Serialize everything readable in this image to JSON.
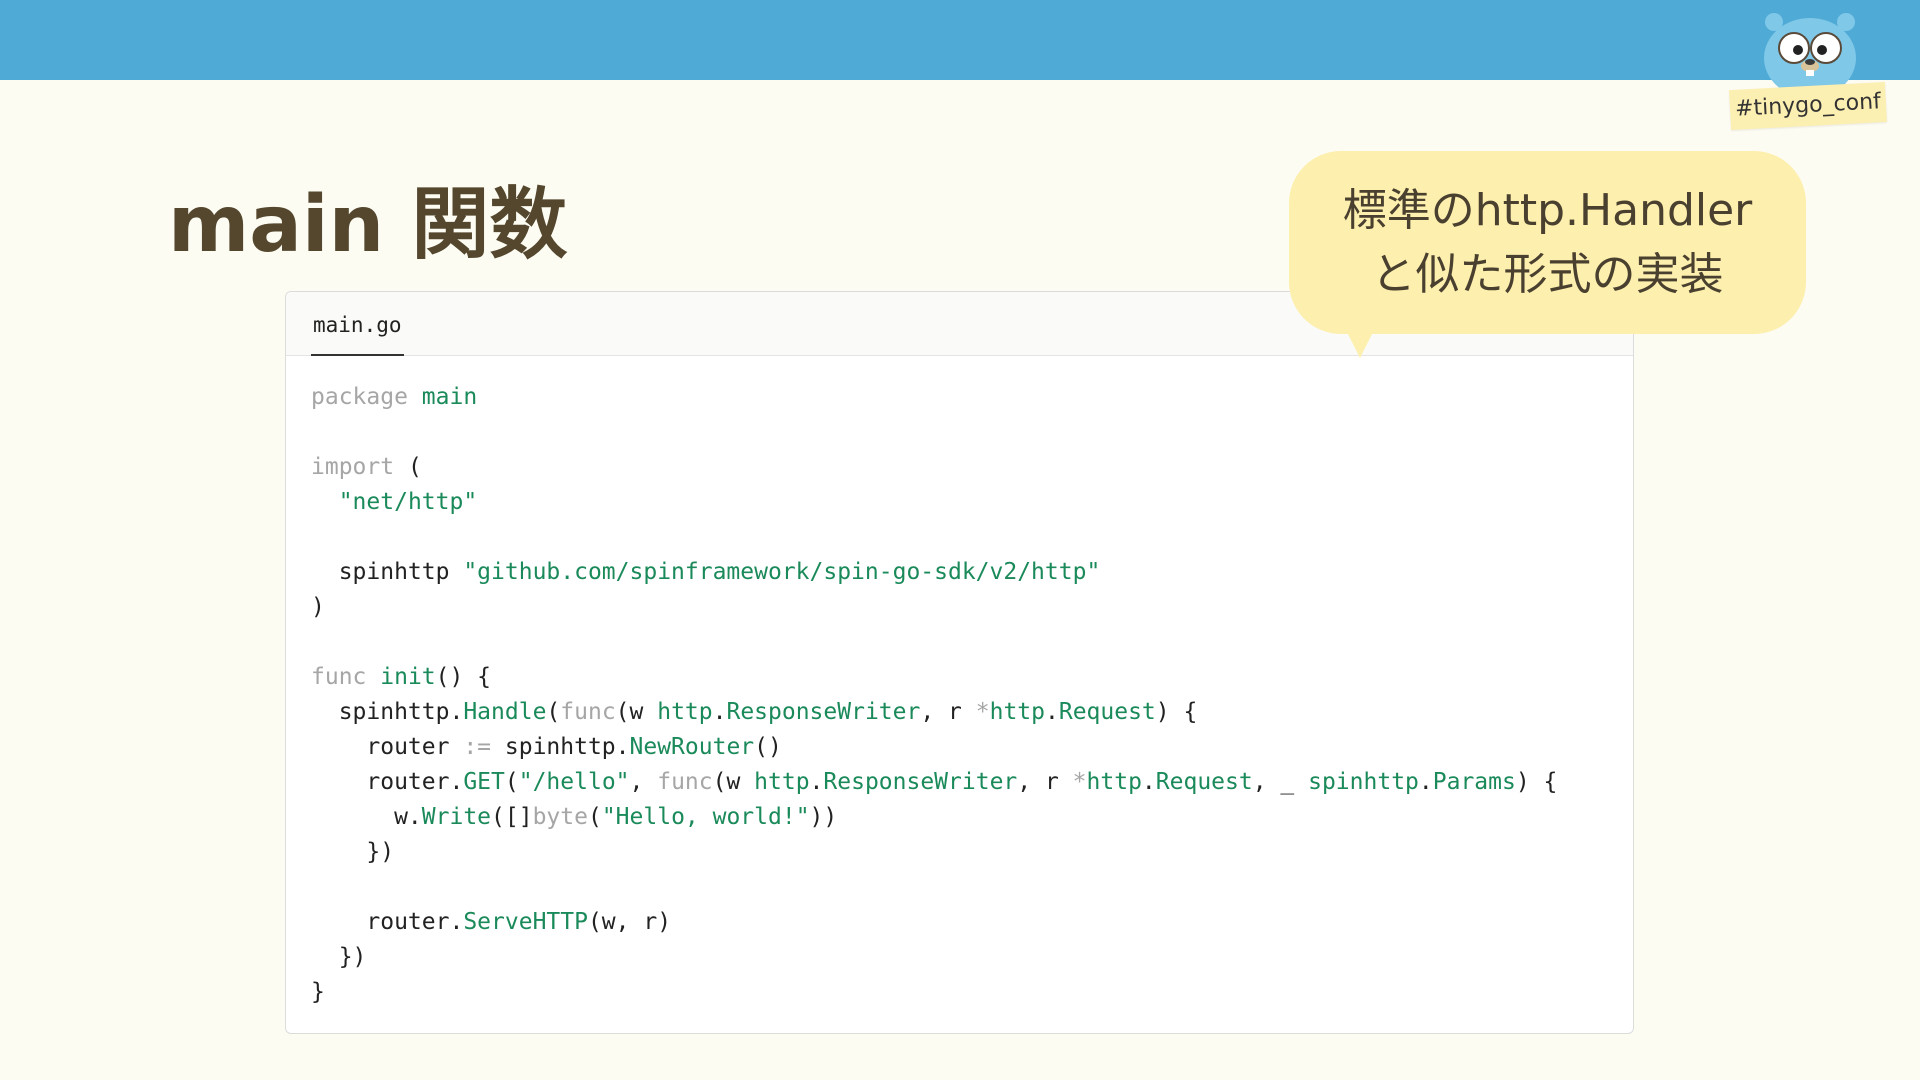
{
  "header": {
    "bar_color": "#4faad6",
    "mascot_icon": "gopher-mascot-icon",
    "hashtag": "#tinygo_conf"
  },
  "slide": {
    "title": "main 関数",
    "callout": {
      "line1": "標準のhttp.Handler",
      "line2": "と似た形式の実装"
    }
  },
  "code_panel": {
    "tab_label": "main.go",
    "lines": [
      [
        {
          "t": "package",
          "k": "kw"
        },
        {
          "t": " ",
          "k": "id"
        },
        {
          "t": "main",
          "k": "fn"
        }
      ],
      [],
      [
        {
          "t": "import",
          "k": "kw"
        },
        {
          "t": " (",
          "k": "pn"
        }
      ],
      [
        {
          "t": "  ",
          "k": "id"
        },
        {
          "t": "\"net/http\"",
          "k": "str"
        }
      ],
      [],
      [
        {
          "t": "  spinhttp ",
          "k": "id"
        },
        {
          "t": "\"github.com/spinframework/spin-go-sdk/v2/http\"",
          "k": "str"
        }
      ],
      [
        {
          "t": ")",
          "k": "pn"
        }
      ],
      [],
      [
        {
          "t": "func",
          "k": "kw"
        },
        {
          "t": " ",
          "k": "id"
        },
        {
          "t": "init",
          "k": "fn"
        },
        {
          "t": "() {",
          "k": "pn"
        }
      ],
      [
        {
          "t": "  spinhttp.",
          "k": "id"
        },
        {
          "t": "Handle",
          "k": "fn"
        },
        {
          "t": "(",
          "k": "pn"
        },
        {
          "t": "func",
          "k": "kw"
        },
        {
          "t": "(w ",
          "k": "id"
        },
        {
          "t": "http",
          "k": "pkg"
        },
        {
          "t": ".",
          "k": "pn"
        },
        {
          "t": "ResponseWriter",
          "k": "pkg"
        },
        {
          "t": ", r ",
          "k": "id"
        },
        {
          "t": "*",
          "k": "op"
        },
        {
          "t": "http",
          "k": "pkg"
        },
        {
          "t": ".",
          "k": "pn"
        },
        {
          "t": "Request",
          "k": "pkg"
        },
        {
          "t": ") {",
          "k": "pn"
        }
      ],
      [
        {
          "t": "    router ",
          "k": "id"
        },
        {
          "t": ":=",
          "k": "op"
        },
        {
          "t": " spinhttp.",
          "k": "id"
        },
        {
          "t": "NewRouter",
          "k": "fn"
        },
        {
          "t": "()",
          "k": "pn"
        }
      ],
      [
        {
          "t": "    router.",
          "k": "id"
        },
        {
          "t": "GET",
          "k": "fn"
        },
        {
          "t": "(",
          "k": "pn"
        },
        {
          "t": "\"/hello\"",
          "k": "str"
        },
        {
          "t": ", ",
          "k": "pn"
        },
        {
          "t": "func",
          "k": "kw"
        },
        {
          "t": "(w ",
          "k": "id"
        },
        {
          "t": "http",
          "k": "pkg"
        },
        {
          "t": ".",
          "k": "pn"
        },
        {
          "t": "ResponseWriter",
          "k": "pkg"
        },
        {
          "t": ", r ",
          "k": "id"
        },
        {
          "t": "*",
          "k": "op"
        },
        {
          "t": "http",
          "k": "pkg"
        },
        {
          "t": ".",
          "k": "pn"
        },
        {
          "t": "Request",
          "k": "pkg"
        },
        {
          "t": ", _ ",
          "k": "id"
        },
        {
          "t": "spinhttp",
          "k": "pkg"
        },
        {
          "t": ".",
          "k": "pn"
        },
        {
          "t": "Params",
          "k": "pkg"
        },
        {
          "t": ") {",
          "k": "pn"
        }
      ],
      [
        {
          "t": "      w.",
          "k": "id"
        },
        {
          "t": "Write",
          "k": "fn"
        },
        {
          "t": "([]",
          "k": "pn"
        },
        {
          "t": "byte",
          "k": "kw"
        },
        {
          "t": "(",
          "k": "pn"
        },
        {
          "t": "\"Hello, world!\"",
          "k": "str"
        },
        {
          "t": "))",
          "k": "pn"
        }
      ],
      [
        {
          "t": "    })",
          "k": "pn"
        }
      ],
      [],
      [
        {
          "t": "    router.",
          "k": "id"
        },
        {
          "t": "ServeHTTP",
          "k": "fn"
        },
        {
          "t": "(w, r)",
          "k": "pn"
        }
      ],
      [
        {
          "t": "  })",
          "k": "pn"
        }
      ],
      [
        {
          "t": "}",
          "k": "pn"
        }
      ]
    ]
  }
}
